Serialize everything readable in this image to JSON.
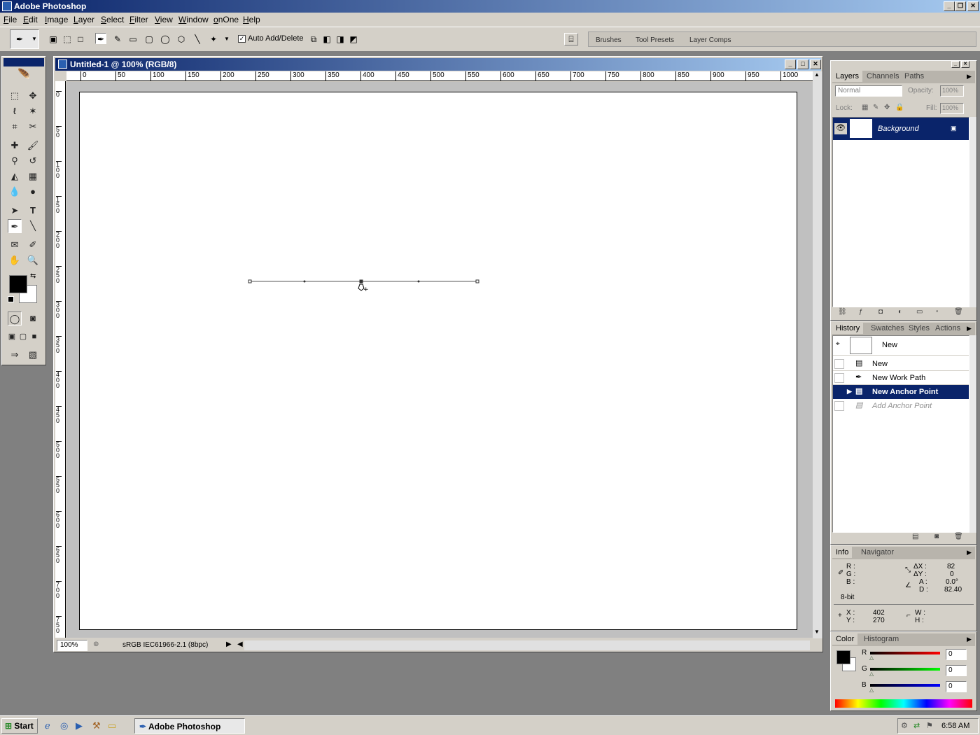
{
  "app": {
    "title": "Adobe Photoshop"
  },
  "menu": [
    "File",
    "Edit",
    "Image",
    "Layer",
    "Select",
    "Filter",
    "View",
    "Window",
    "onOne",
    "Help"
  ],
  "options": {
    "auto_add_delete": "Auto Add/Delete",
    "auto_add_delete_checked": true
  },
  "well_tabs": [
    "Brushes",
    "Tool Presets",
    "Layer Comps"
  ],
  "document": {
    "title": "Untitled-1 @ 100% (RGB/8)",
    "zoom": "100%",
    "profile": "sRGB IEC61966-2.1 (8bpc)",
    "hruler": [
      "0",
      "50",
      "100",
      "150",
      "200",
      "250",
      "300",
      "350",
      "400",
      "450",
      "500",
      "550",
      "600",
      "650",
      "700",
      "750",
      "800",
      "850",
      "900",
      "950",
      "1000"
    ],
    "vruler": [
      "0",
      "5 0",
      "1 0 0",
      "1 5 0",
      "2 0 0",
      "2 5 0",
      "3 0 0",
      "3 5 0",
      "4 0 0",
      "4 5 0",
      "5 0 0",
      "5 5 0",
      "6 0 0",
      "6 5 0",
      "7 0 0",
      "7 5 0"
    ]
  },
  "layers_panel": {
    "tabs": [
      "Layers",
      "Channels",
      "Paths"
    ],
    "blend_mode": "Normal",
    "opacity_label": "Opacity:",
    "opacity": "100%",
    "lock_label": "Lock:",
    "fill_label": "Fill:",
    "fill": "100%",
    "layers": [
      {
        "name": "Background"
      }
    ]
  },
  "history_panel": {
    "tabs": [
      "History",
      "Swatches",
      "Styles",
      "Actions"
    ],
    "snapshot": "New",
    "items": [
      {
        "label": "New",
        "state": "normal"
      },
      {
        "label": "New Work Path",
        "state": "normal"
      },
      {
        "label": "New Anchor Point",
        "state": "selected"
      },
      {
        "label": "Add Anchor Point",
        "state": "undone"
      }
    ]
  },
  "info_panel": {
    "tabs": [
      "Info",
      "Navigator"
    ],
    "r_label": "R :",
    "g_label": "G :",
    "b_label": "B :",
    "bitdepth": "8-bit",
    "dx_label": "ΔX :",
    "dx": "82",
    "dy_label": "ΔY :",
    "dy": "0",
    "a_label": "A :",
    "a": "0.0°",
    "d_label": "D :",
    "d": "82.40",
    "x_label": "X :",
    "x": "402",
    "y_label": "Y :",
    "y": "270",
    "w_label": "W :",
    "h_label": "H :"
  },
  "color_panel": {
    "tabs": [
      "Color",
      "Histogram"
    ],
    "r_label": "R",
    "r": "0",
    "g_label": "G",
    "g": "0",
    "b_label": "B",
    "b": "0",
    "foreground": "#000000",
    "background": "#ffffff"
  },
  "taskbar": {
    "start": "Start",
    "task": "Adobe Photoshop",
    "clock": "6:58 AM"
  }
}
